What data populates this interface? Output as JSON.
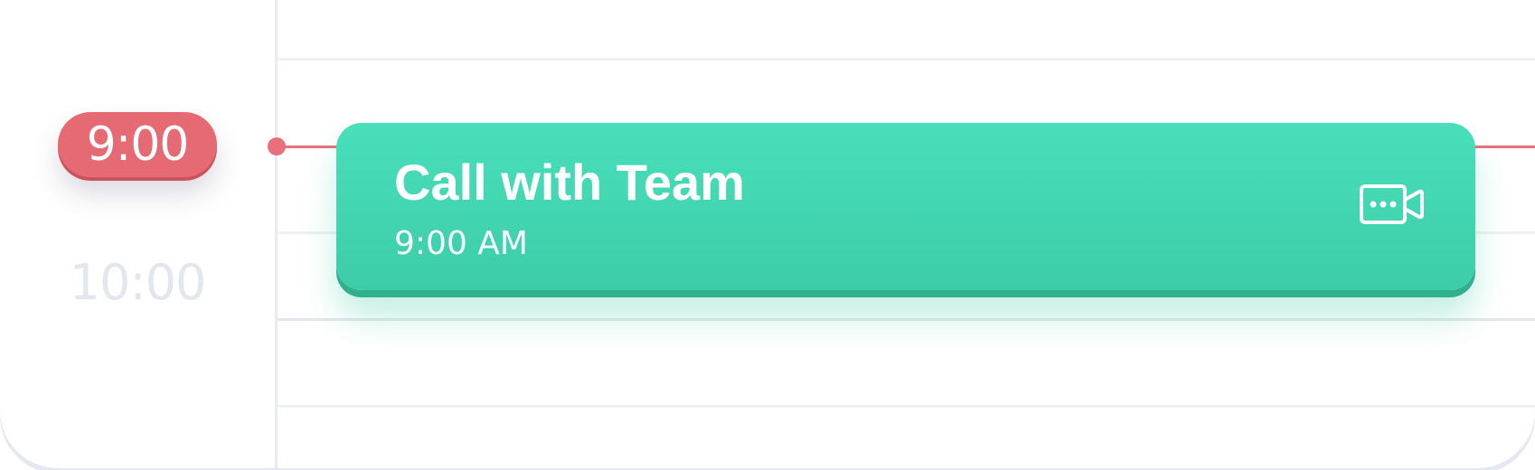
{
  "timeline": {
    "current_time": "9:00",
    "next_hour": "10:00"
  },
  "event": {
    "title": "Call with Team",
    "time": "9:00 AM",
    "icon": "video-call-icon"
  },
  "colors": {
    "now_indicator": "#e66a74",
    "event_background": "#44d8b5",
    "event_shadow": "#2fb08e",
    "grid_line": "#eef0f5",
    "muted_label": "#e4e6ee"
  }
}
